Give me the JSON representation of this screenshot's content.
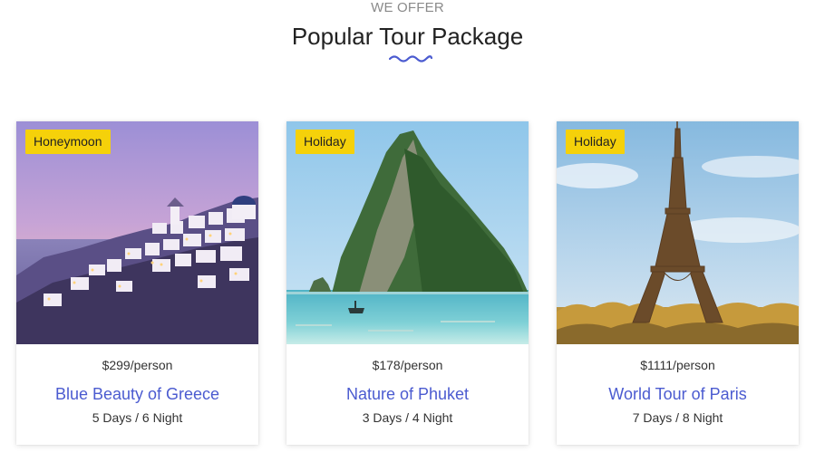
{
  "section": {
    "eyebrow": "WE OFFER",
    "title": "Popular Tour Package",
    "accent_color": "#4b5bd0"
  },
  "packages": [
    {
      "badge": "Honeymoon",
      "price": "$299/person",
      "name": "Blue Beauty of Greece",
      "duration": "5 Days / 6 Night",
      "image": "santorini-village-dusk"
    },
    {
      "badge": "Holiday",
      "price": "$178/person",
      "name": "Nature of Phuket",
      "duration": "3 Days / 4 Night",
      "image": "phuket-limestone-island"
    },
    {
      "badge": "Holiday",
      "price": "$1111/person",
      "name": "World Tour of Paris",
      "duration": "7 Days / 8 Night",
      "image": "eiffel-tower"
    }
  ],
  "badge_color": "#f5d10a"
}
